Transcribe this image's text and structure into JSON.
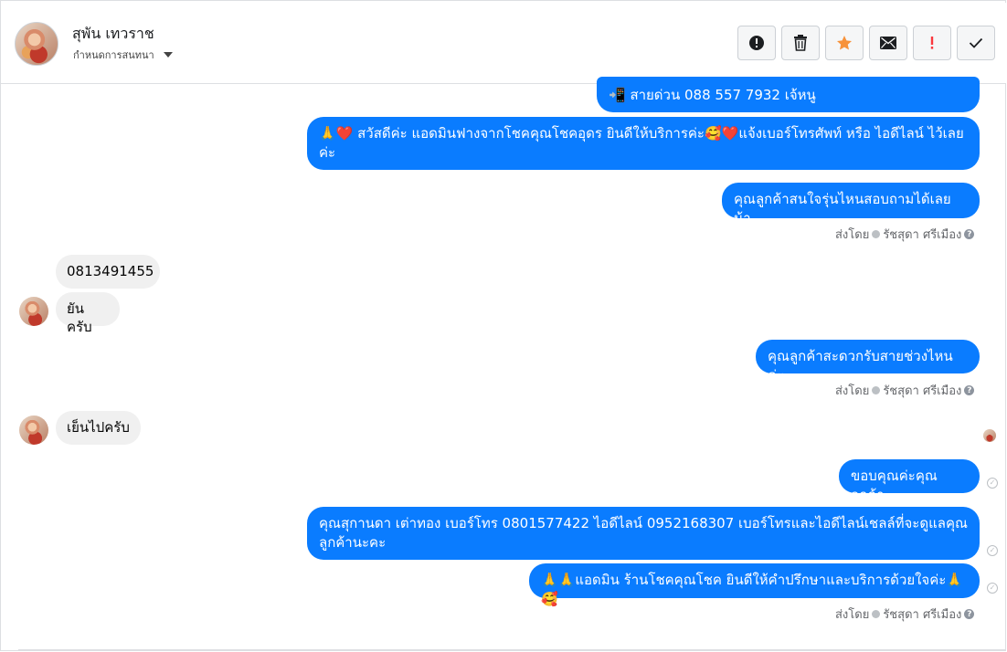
{
  "header": {
    "contact_name": "สุพัน เทวราช",
    "assign_label": "กำหนดการสนทนา"
  },
  "toolbar": {
    "buttons": [
      {
        "name": "report-button",
        "icon": "exclamation-circle-icon"
      },
      {
        "name": "delete-button",
        "icon": "trash-icon"
      },
      {
        "name": "star-button",
        "icon": "star-icon"
      },
      {
        "name": "mark-unread-button",
        "icon": "envelope-icon"
      },
      {
        "name": "spam-button",
        "icon": "exclamation-icon"
      },
      {
        "name": "done-button",
        "icon": "check-icon"
      }
    ]
  },
  "messages": {
    "m1": "📲 สายด่วน 088 557 7932 เจ้หนู",
    "m2": "🙏❤️ สวัสดีค่ะ แอดมินฟางจากโชคคุณโชคอุดร ยินดีให้บริการค่ะ🥰❤️แจ้งเบอร์โทรศัพท์ หรือ ไอดีไลน์  ไว้เลยค่ะ",
    "m3": "คุณลูกค้าสนใจรุ่นไหนสอบถามได้เลยน้า",
    "in1": "0813491455",
    "in2": "ยันครับ",
    "m4": "คุณลูกค้าสะดวกรับสายช่วงไหนค่ะ",
    "in3": "เย็นไปครับ",
    "m5": "ขอบคุณค่ะคุณลูกค้า",
    "m6": "คุณสุกานดา เต่าทอง      เบอร์โทร 0801577422  ไอดีไลน์ 0952168307     เบอร์โทรและไอดีไลน์เชลล์ที่จะดูแลคุณลูกค้านะคะ",
    "m7": "🙏🙏แอดมิน ร้านโชคคุณโชค ยินดีให้คำปรึกษาและบริการด้วยใจค่ะ🙏🥰"
  },
  "meta": {
    "sent_by": "ส่งโดย",
    "agent": "รัชสุดา ศรีเมือง"
  },
  "colors": {
    "outgoing": "#0a7cff",
    "incoming": "#f0f0f0",
    "star": "#f7923a",
    "spam": "#fa383e"
  }
}
